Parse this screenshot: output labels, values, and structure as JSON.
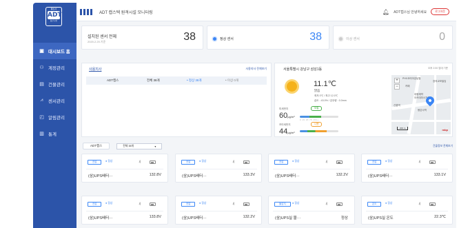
{
  "logo": {
    "top": "통신사",
    "main": "ADT",
    "bottom": "통신 보안"
  },
  "sidebar": {
    "items": [
      {
        "icon": "▣",
        "label": "대시보드 홈"
      },
      {
        "icon": "⚇",
        "label": "계정관리"
      },
      {
        "icon": "▤",
        "label": "건물관리"
      },
      {
        "icon": "⩘",
        "label": "센서관리"
      },
      {
        "icon": "◰",
        "label": "알림관리"
      },
      {
        "icon": "▥",
        "label": "통계"
      }
    ]
  },
  "header": {
    "title": "ADT 캡스텍 원격시설 모니터링",
    "welcome": "ADT캡스님 안녕하세요",
    "logout": "로그아웃"
  },
  "stats": {
    "total_label": "설치된 센서 전체",
    "total_sub": "2020.2.20 기준",
    "total_value": "38",
    "normal_label": "정상 센서",
    "normal_value": "38",
    "abnormal_label": "이상 센서",
    "abnormal_value": "0"
  },
  "site_panel": {
    "title": "사용지사",
    "more": "사용지사 전체보기",
    "row": {
      "name": "ADT캡스",
      "total": "전체 38개",
      "normal": "• 정상 38개",
      "abnormal": "• 이상 0개"
    }
  },
  "weather": {
    "title": "서울특별시 강남구 삼성1동",
    "time": "오후 2:00 업데 기준",
    "temperature": "11.1℃",
    "condition": "맑음",
    "minmax": "최저 0℃ / 최고 12.0℃",
    "humidity": "습도 : 43.0% / 강우량 : 0.0mm",
    "pm10_label": "미세먼지",
    "pm10_value": "60",
    "pm10_unit": "μg/m³",
    "pm10_grade": "보통",
    "pm25_label": "초미세먼지",
    "pm25_value": "44",
    "pm25_unit": "μg/m³",
    "pm25_grade": "나쁨",
    "scale_ticks": "0    15    35    75    151+"
  },
  "map": {
    "labels": [
      "PHX코리아강남점",
      "장의교보빌딩",
      "대웅제약",
      "아카데미사거리",
      "선릉역",
      "봉은사역",
      "카페"
    ],
    "scale": "200 m",
    "brand": "mbp"
  },
  "filter": {
    "tab": "ADT캡스",
    "select": "전체 38개",
    "more_label": "건물정보 전체보기"
  },
  "cards": [
    {
      "tag": "전압",
      "status": "● 정상",
      "name": "(삼)UPS배터···",
      "value": "132.8V"
    },
    {
      "tag": "전압",
      "status": "● 정상",
      "name": "(삼)UPS배터···",
      "value": "133.3V"
    },
    {
      "tag": "전압",
      "status": "● 정상",
      "name": "(삼)UPS배터···",
      "value": "132.2V"
    },
    {
      "tag": "전압",
      "status": "● 정상",
      "name": "(삼)UPS배터···",
      "value": "133.1V"
    },
    {
      "tag": "전압",
      "status": "● 정상",
      "name": "(삼)UPS배터···",
      "value": "133.8V"
    },
    {
      "tag": "전압",
      "status": "● 정상",
      "name": "(삼)UPS배터···",
      "value": "132.2V"
    },
    {
      "tag": "물감지",
      "status": "● 정상",
      "name": "(삼)UPS실 물···",
      "value": "정상"
    },
    {
      "tag": "온도",
      "status": "● 정상",
      "name": "(삼)UPS실 온도",
      "value": "22.3℃"
    }
  ],
  "colors": {
    "sidebar": "#2c54a9",
    "accent": "#3b86f5",
    "abnormal": "#aaaaaa",
    "good": "#4ab04a",
    "bad": "#f0a030"
  }
}
